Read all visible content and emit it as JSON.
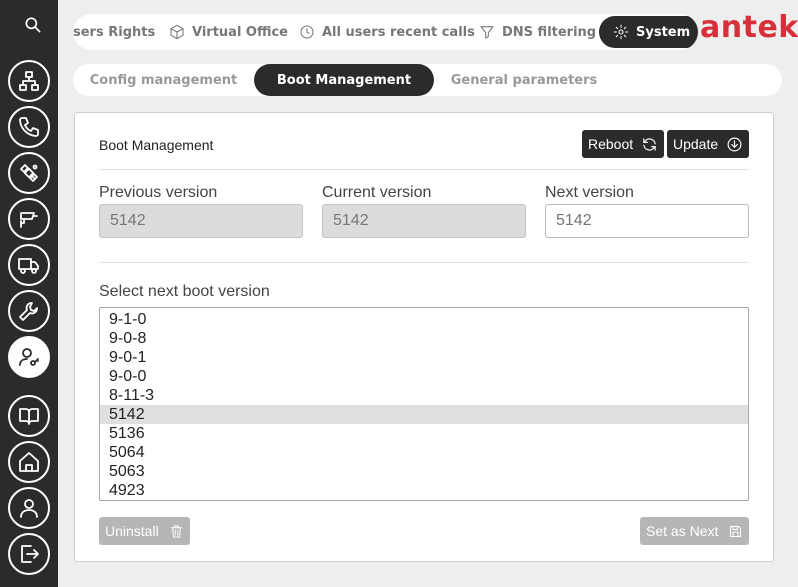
{
  "brand": {
    "logo_text": "antek",
    "color": "#d7303a"
  },
  "sidebar": {
    "items": [
      {
        "icon": "network-icon"
      },
      {
        "icon": "phone-icon"
      },
      {
        "icon": "satellite-icon"
      },
      {
        "icon": "cctv-icon"
      },
      {
        "icon": "truck-icon"
      },
      {
        "icon": "wrench-icon"
      },
      {
        "icon": "user-key-icon",
        "active": true
      },
      {
        "icon": "book-icon"
      },
      {
        "icon": "home-icon"
      },
      {
        "icon": "user-icon"
      },
      {
        "icon": "logout-icon"
      }
    ]
  },
  "top_tabs": [
    {
      "label": "sers Rights",
      "icon": ""
    },
    {
      "label": "Virtual Office",
      "icon": "cube-icon"
    },
    {
      "label": "All users recent calls",
      "icon": "clock-icon"
    },
    {
      "label": "DNS filtering",
      "icon": "filter-icon"
    },
    {
      "label": "System",
      "icon": "gear-icon",
      "active": true
    }
  ],
  "sub_tabs": [
    {
      "label": "Config management"
    },
    {
      "label": "Boot Management",
      "active": true
    },
    {
      "label": "General parameters"
    }
  ],
  "panel": {
    "title": "Boot Management",
    "reboot_label": "Reboot",
    "update_label": "Update",
    "previous_label": "Previous version",
    "previous_value": "5142",
    "current_label": "Current version",
    "current_value": "5142",
    "next_label": "Next version",
    "next_placeholder": "5142",
    "list_label": "Select next boot version",
    "versions": [
      "9-1-0",
      "9-0-8",
      "9-0-1",
      "9-0-0",
      "8-11-3",
      "5142",
      "5136",
      "5064",
      "5063",
      "4923"
    ],
    "selected_version": "5142",
    "uninstall_label": "Uninstall",
    "set_next_label": "Set as Next"
  }
}
